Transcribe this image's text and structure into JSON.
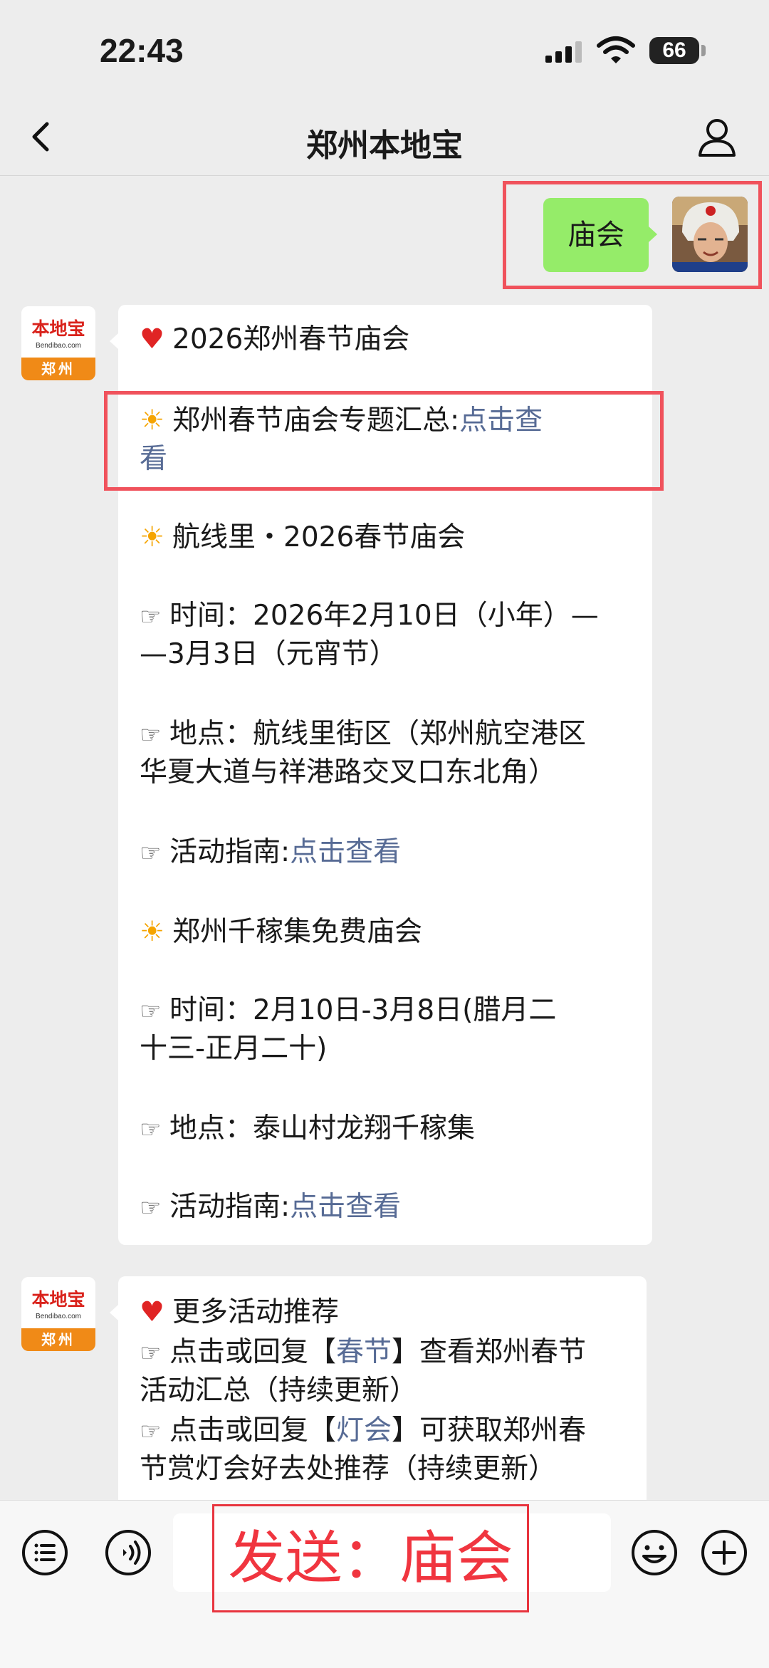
{
  "status_bar": {
    "time": "22:43",
    "battery": "66"
  },
  "header": {
    "title": "郑州本地宝"
  },
  "user_message": {
    "text": "庙会"
  },
  "bot_avatar": {
    "brand": "本地宝",
    "site": "Bendibao.com",
    "city": "郑州"
  },
  "reply1": {
    "title": "2026郑州春节庙会",
    "summary_label": "郑州春节庙会专题汇总:",
    "summary_link_a": "点击查",
    "summary_link_b": "看",
    "event1_title": "航线里・2026春节庙会",
    "event1_time_a": "时间：2026年2月10日（小年）—",
    "event1_time_b": "—3月3日（元宵节）",
    "event1_place_a": "地点：航线里街区（郑州航空港区",
    "event1_place_b": "华夏大道与祥港路交叉口东北角）",
    "event1_guide_label": "活动指南:",
    "event1_guide_link": "点击查看",
    "event2_title": "郑州千稼集免费庙会",
    "event2_time_a": "时间：2月10日-3月8日(腊月二",
    "event2_time_b": "十三-正月二十)",
    "event2_place": "地点：泰山村龙翔千稼集",
    "event2_guide_label": "活动指南:",
    "event2_guide_link": "点击查看"
  },
  "reply2": {
    "title": "更多活动推荐",
    "item1_pre": "点击或回复【",
    "item1_link": "春节",
    "item1_post": "】查看郑州春节",
    "item1_b": "活动汇总（持续更新）",
    "item2_pre": "点击或回复【",
    "item2_link": "灯会",
    "item2_post": "】可获取郑州春",
    "item2_b": "节赏灯会好去处推荐（持续更新）"
  },
  "annotation": {
    "send_label": "发送：庙会"
  },
  "colors": {
    "link": "#576b95",
    "outgoing_bubble": "#95ec69",
    "highlight": "#f0525c"
  }
}
